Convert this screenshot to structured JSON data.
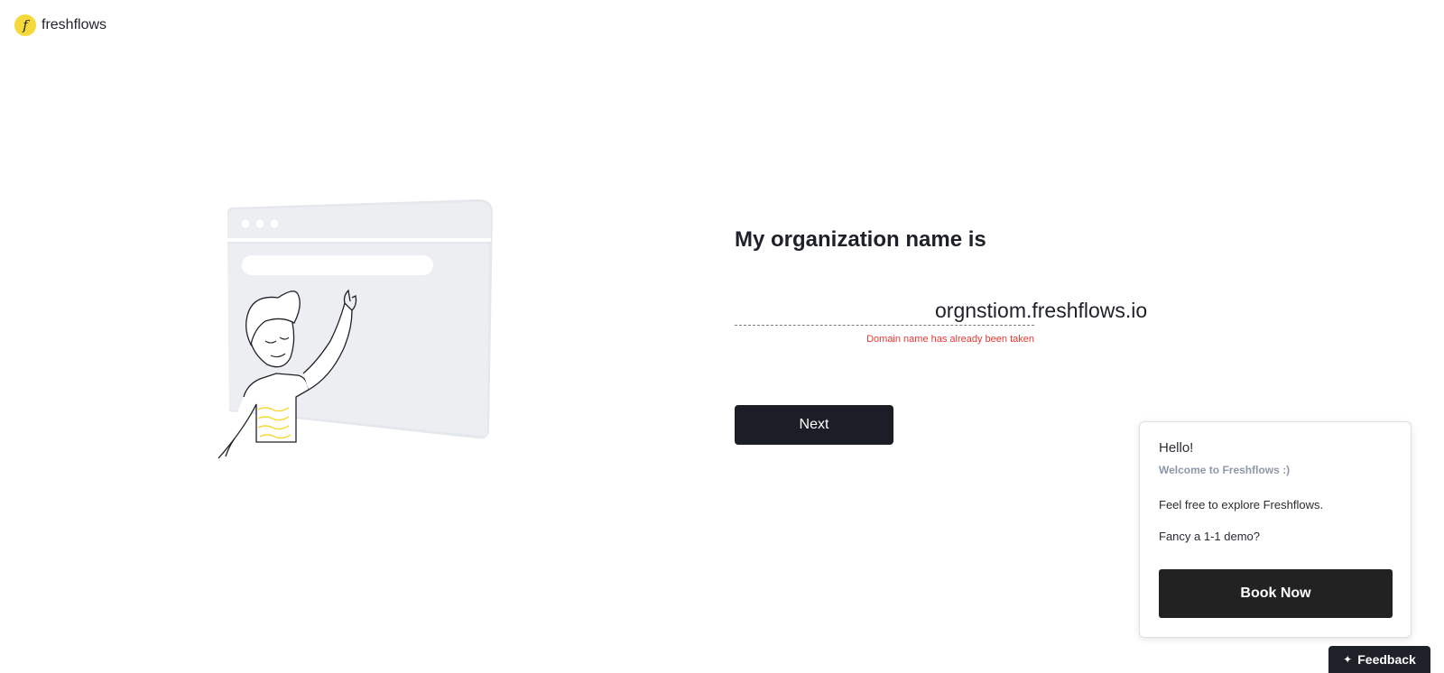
{
  "brand": {
    "name": "freshflows",
    "mark": "f"
  },
  "main": {
    "heading": "My organization name is",
    "domain_value": "",
    "domain_suffix": "orgnstiom.freshflows.io",
    "error": "Domain name has already been taken",
    "next_label": "Next"
  },
  "welcome": {
    "hello": "Hello!",
    "subtitle": "Welcome to Freshflows :)",
    "explore": "Feel free to explore Freshflows.",
    "demo": "Fancy a 1-1 demo?",
    "book_label": "Book Now"
  },
  "feedback": {
    "label": "Feedback",
    "icon": "sparkle-icon"
  },
  "colors": {
    "accent_yellow": "#f5d83a",
    "primary_dark": "#1b1e26",
    "error_red": "#e53935",
    "illustration_gray": "#eceef1"
  }
}
